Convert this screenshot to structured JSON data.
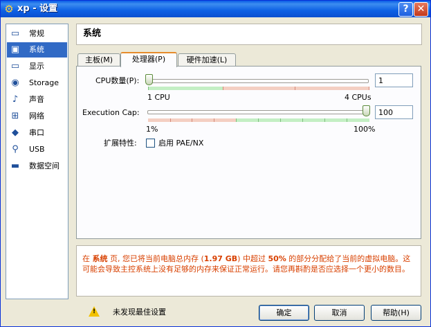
{
  "window": {
    "title": "xp - 设置"
  },
  "titlebar": {
    "help_glyph": "?",
    "close_glyph": "✕"
  },
  "sidebar": {
    "items": [
      {
        "label": "常规",
        "icon": "monitor-icon"
      },
      {
        "label": "系统",
        "icon": "chip-icon",
        "selected": true
      },
      {
        "label": "显示",
        "icon": "display-icon"
      },
      {
        "label": "Storage",
        "icon": "disk-icon"
      },
      {
        "label": "声音",
        "icon": "speaker-icon"
      },
      {
        "label": "网络",
        "icon": "network-icon"
      },
      {
        "label": "串口",
        "icon": "serial-port-icon"
      },
      {
        "label": "USB",
        "icon": "usb-icon"
      },
      {
        "label": "数据空间",
        "icon": "folder-icon"
      }
    ]
  },
  "page": {
    "title": "系统"
  },
  "tabs": [
    "主板(M)",
    "处理器(P)",
    "硬件加速(L)"
  ],
  "processor": {
    "cpu_label": "CPU数量(P):",
    "cpu_value": "1",
    "cpu_min_label": "1 CPU",
    "cpu_max_label": "4 CPUs",
    "cap_label": "Execution Cap:",
    "cap_value": "100",
    "cap_min_label": "1%",
    "cap_max_label": "100%",
    "ext_label": "扩展特性:",
    "pae_label": "启用 PAE/NX",
    "pae_checked": false
  },
  "warning": {
    "p1": "在 ",
    "b1": "系统",
    "p2": " 页, 您已将当前电脑总内存 (",
    "b2": "1.97 GB",
    "p3": ") 中超过 ",
    "b3": "50%",
    "p4": " 的部分分配给了当前的虚拟电脑。这可能会导致主控系统上没有足够的内存来保证正常运行。请您再斟酌是否应选择一个更小的数目。"
  },
  "status": {
    "text": "未发现最佳设置",
    "icon": "warning-icon"
  },
  "buttons": {
    "ok": "确定",
    "cancel": "取消",
    "help": "帮助(H)"
  },
  "colors": {
    "titlebar": "#0a5ce6",
    "selection": "#316ac5",
    "warning_text": "#d84000",
    "tab_accent": "#e68b2c"
  }
}
